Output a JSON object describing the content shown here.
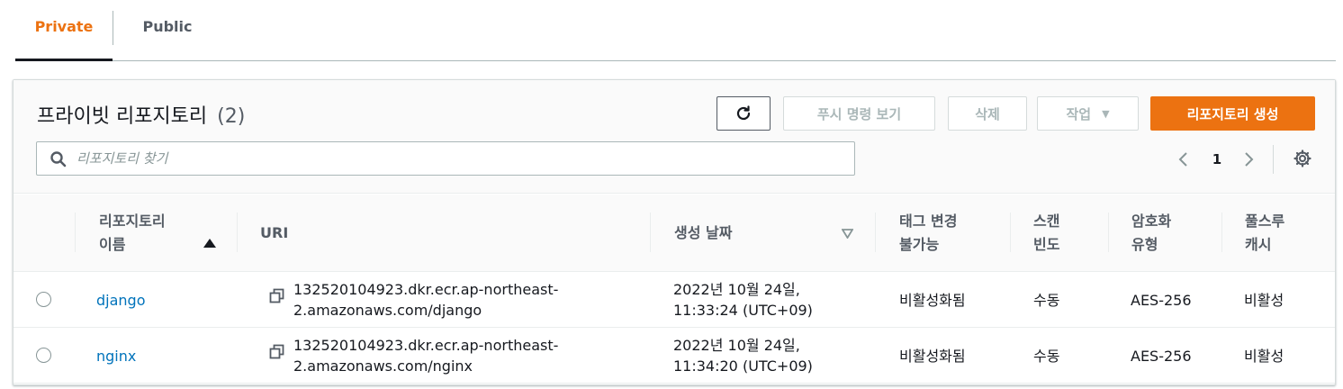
{
  "tabs": [
    {
      "label": "Private",
      "active": true
    },
    {
      "label": "Public",
      "active": false
    }
  ],
  "panel": {
    "title": "프라이빗 리포지토리",
    "count": "(2)",
    "buttons": {
      "refresh_icon": "refresh-icon",
      "push_commands": "푸시 명령 보기",
      "delete": "삭제",
      "actions": "작업",
      "create": "리포지토리 생성"
    },
    "search": {
      "placeholder": "리포지토리 찾기",
      "value": ""
    },
    "pagination": {
      "current_page": "1"
    }
  },
  "table": {
    "columns": {
      "name_line1": "리포지토리",
      "name_line2": "이름",
      "uri": "URI",
      "created": "생성 날짜",
      "immutability_line1": "태그 변경",
      "immutability_line2": "불가능",
      "scan_line1": "스캔",
      "scan_line2": "빈도",
      "encryption_line1": "암호화",
      "encryption_line2": "유형",
      "pull_line1": "풀스루",
      "pull_line2": "캐시"
    },
    "rows": [
      {
        "name": "django",
        "uri_line1": "132520104923.dkr.ecr.ap-northeast-",
        "uri_line2": "2.amazonaws.com/django",
        "created_line1": "2022년 10월 24일,",
        "created_line2": "11:33:24 (UTC+09)",
        "immutability": "비활성화됨",
        "scan": "수동",
        "encryption": "AES-256",
        "pull_through": "비활성"
      },
      {
        "name": "nginx",
        "uri_line1": "132520104923.dkr.ecr.ap-northeast-",
        "uri_line2": "2.amazonaws.com/nginx",
        "created_line1": "2022년 10월 24일,",
        "created_line2": "11:34:20 (UTC+09)",
        "immutability": "비활성화됨",
        "scan": "수동",
        "encryption": "AES-256",
        "pull_through": "비활성"
      }
    ]
  },
  "colors": {
    "accent": "#ec7211",
    "link": "#0073bb",
    "text": "#16191f",
    "muted": "#545b64"
  }
}
